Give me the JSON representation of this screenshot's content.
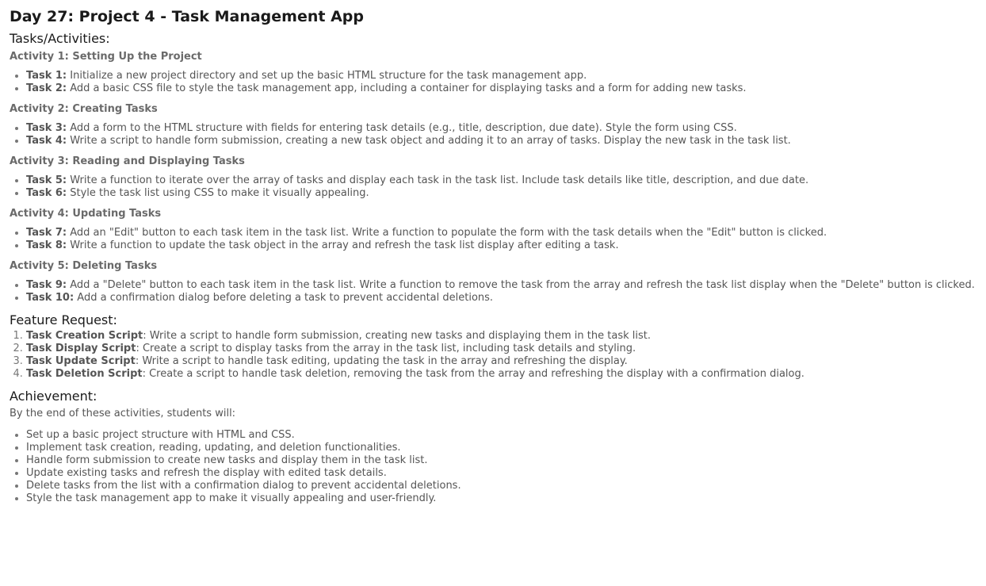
{
  "title": "Day 27: Project 4 - Task Management App",
  "tasks_section": {
    "heading": "Tasks/Activities:",
    "activities": [
      {
        "heading": "Activity 1: Setting Up the Project",
        "tasks": [
          {
            "label": "Task 1:",
            "text": " Initialize a new project directory and set up the basic HTML structure for the task management app."
          },
          {
            "label": "Task 2:",
            "text": " Add a basic CSS file to style the task management app, including a container for displaying tasks and a form for adding new tasks."
          }
        ]
      },
      {
        "heading": "Activity 2: Creating Tasks",
        "tasks": [
          {
            "label": "Task 3:",
            "text": " Add a form to the HTML structure with fields for entering task details (e.g., title, description, due date). Style the form using CSS."
          },
          {
            "label": "Task 4:",
            "text": " Write a script to handle form submission, creating a new task object and adding it to an array of tasks. Display the new task in the task list."
          }
        ]
      },
      {
        "heading": "Activity 3: Reading and Displaying Tasks",
        "tasks": [
          {
            "label": "Task 5:",
            "text": " Write a function to iterate over the array of tasks and display each task in the task list. Include task details like title, description, and due date."
          },
          {
            "label": "Task 6:",
            "text": " Style the task list using CSS to make it visually appealing."
          }
        ]
      },
      {
        "heading": "Activity 4: Updating Tasks",
        "tasks": [
          {
            "label": "Task 7:",
            "text": " Add an \"Edit\" button to each task item in the task list. Write a function to populate the form with the task details when the \"Edit\" button is clicked."
          },
          {
            "label": "Task 8:",
            "text": " Write a function to update the task object in the array and refresh the task list display after editing a task."
          }
        ]
      },
      {
        "heading": "Activity 5: Deleting Tasks",
        "tasks": [
          {
            "label": "Task 9:",
            "text": " Add a \"Delete\" button to each task item in the task list. Write a function to remove the task from the array and refresh the task list display when the \"Delete\" button is clicked."
          },
          {
            "label": "Task 10:",
            "text": " Add a confirmation dialog before deleting a task to prevent accidental deletions."
          }
        ]
      }
    ]
  },
  "feature_section": {
    "heading": "Feature Request:",
    "items": [
      {
        "label": "Task Creation Script",
        "text": ": Write a script to handle form submission, creating new tasks and displaying them in the task list."
      },
      {
        "label": "Task Display Script",
        "text": ": Create a script to display tasks from the array in the task list, including task details and styling."
      },
      {
        "label": "Task Update Script",
        "text": ": Write a script to handle task editing, updating the task in the array and refreshing the display."
      },
      {
        "label": "Task Deletion Script",
        "text": ": Create a script to handle task deletion, removing the task from the array and refreshing the display with a confirmation dialog."
      }
    ]
  },
  "achievement_section": {
    "heading": "Achievement:",
    "intro": "By the end of these activities, students will:",
    "items": [
      "Set up a basic project structure with HTML and CSS.",
      "Implement task creation, reading, updating, and deletion functionalities.",
      "Handle form submission to create new tasks and display them in the task list.",
      "Update existing tasks and refresh the display with edited task details.",
      "Delete tasks from the list with a confirmation dialog to prevent accidental deletions.",
      "Style the task management app to make it visually appealing and user-friendly."
    ]
  }
}
